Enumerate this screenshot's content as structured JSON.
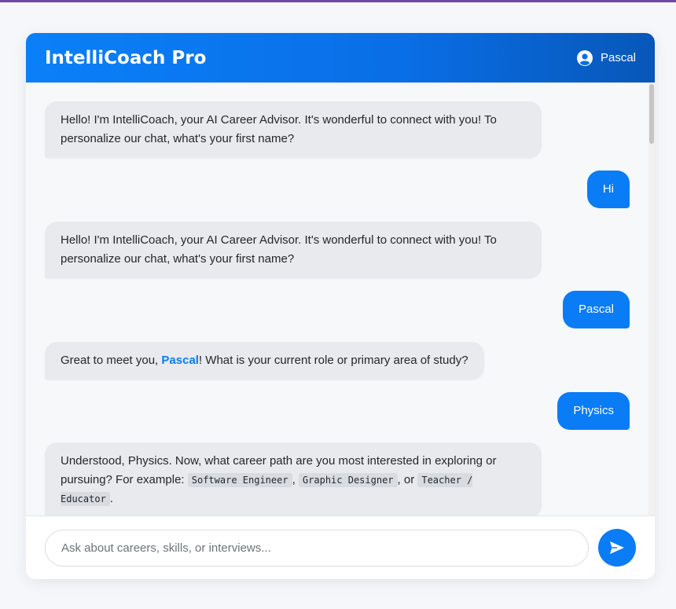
{
  "header": {
    "title": "IntelliCoach Pro",
    "user_name": "Pascal",
    "user_icon": "user-circle-icon"
  },
  "messages": [
    {
      "role": "bot",
      "text": "Hello! I'm IntelliCoach, your AI Career Advisor. It's wonderful to connect with you! To personalize our chat, what's your first name?"
    },
    {
      "role": "user",
      "text": "Hi"
    },
    {
      "role": "bot",
      "text": "Hello! I'm IntelliCoach, your AI Career Advisor. It's wonderful to connect with you! To personalize our chat, what's your first name?"
    },
    {
      "role": "user",
      "text": "Pascal"
    },
    {
      "role": "bot",
      "prefix": "Great to meet you, ",
      "highlight": "Pascal",
      "suffix": "! What is your current role or primary area of study?"
    },
    {
      "role": "user",
      "text": "Physics"
    },
    {
      "role": "bot",
      "prefix": "Understood, Physics. Now, what career path are you most interested in exploring or pursuing? For example: ",
      "examples": [
        "Software Engineer",
        "Graphic Designer",
        "Teacher / Educator"
      ],
      "sep1": ", ",
      "sep2": ", or ",
      "suffix": "."
    }
  ],
  "composer": {
    "placeholder": "Ask about careers, skills, or interviews...",
    "send_icon": "send-icon"
  },
  "colors": {
    "accent": "#0a7cf5",
    "header_dark": "#0757b8",
    "bot_bubble": "#e8eaed",
    "top_strip": "#6f48a8"
  }
}
